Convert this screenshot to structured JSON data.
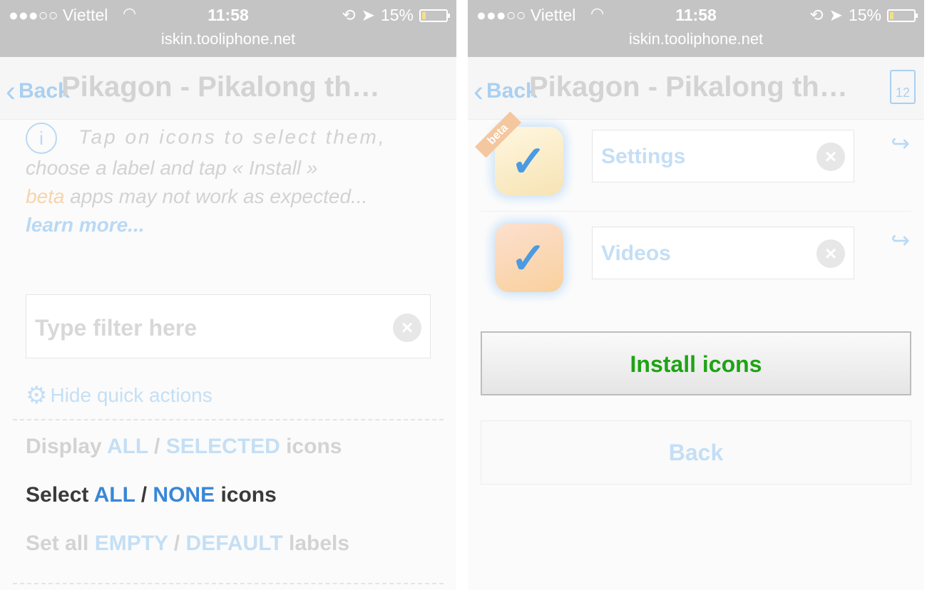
{
  "status": {
    "carrier": "●●●○○ Viettel",
    "wifi_icon": "wifi-icon",
    "time": "11:58",
    "rotation_lock_icon": "lock-rotation-icon",
    "location_icon": "location-arrow-icon",
    "battery": "15%",
    "battery_level": 0.15
  },
  "url": "iskin.tooliphone.net",
  "nav": {
    "back_label": "Back",
    "title": "Pikagon - Pikalong th…",
    "download_count": "12"
  },
  "left": {
    "info_line1": "Tap on icons to select them,",
    "info_line2": "choose a label and tap « Install »",
    "beta_word": "beta",
    "beta_rest": " apps may not work as expected...",
    "learn_more": "learn more...",
    "filter_placeholder": "Type filter here",
    "quick_actions": "Hide quick actions",
    "display": {
      "prefix": "Display ",
      "all": "ALL",
      "sep": " / ",
      "selected": "SELECTED",
      "suffix": " icons"
    },
    "select": {
      "prefix": "Select ",
      "all": "ALL",
      "sep": " / ",
      "none": "NONE",
      "suffix": " icons"
    },
    "labels": {
      "prefix": "Set all ",
      "empty": "EMPTY",
      "sep": " / ",
      "default": "DEFAULT",
      "suffix": " labels"
    }
  },
  "right": {
    "ribbon": "beta",
    "apps": [
      {
        "label": "Settings"
      },
      {
        "label": "Videos"
      }
    ],
    "install_button": "Install icons",
    "back_button": "Back"
  },
  "colors": {
    "accent": "#3a87d6",
    "install_green": "#1fa314",
    "status_gray": "#c4c4c4"
  }
}
